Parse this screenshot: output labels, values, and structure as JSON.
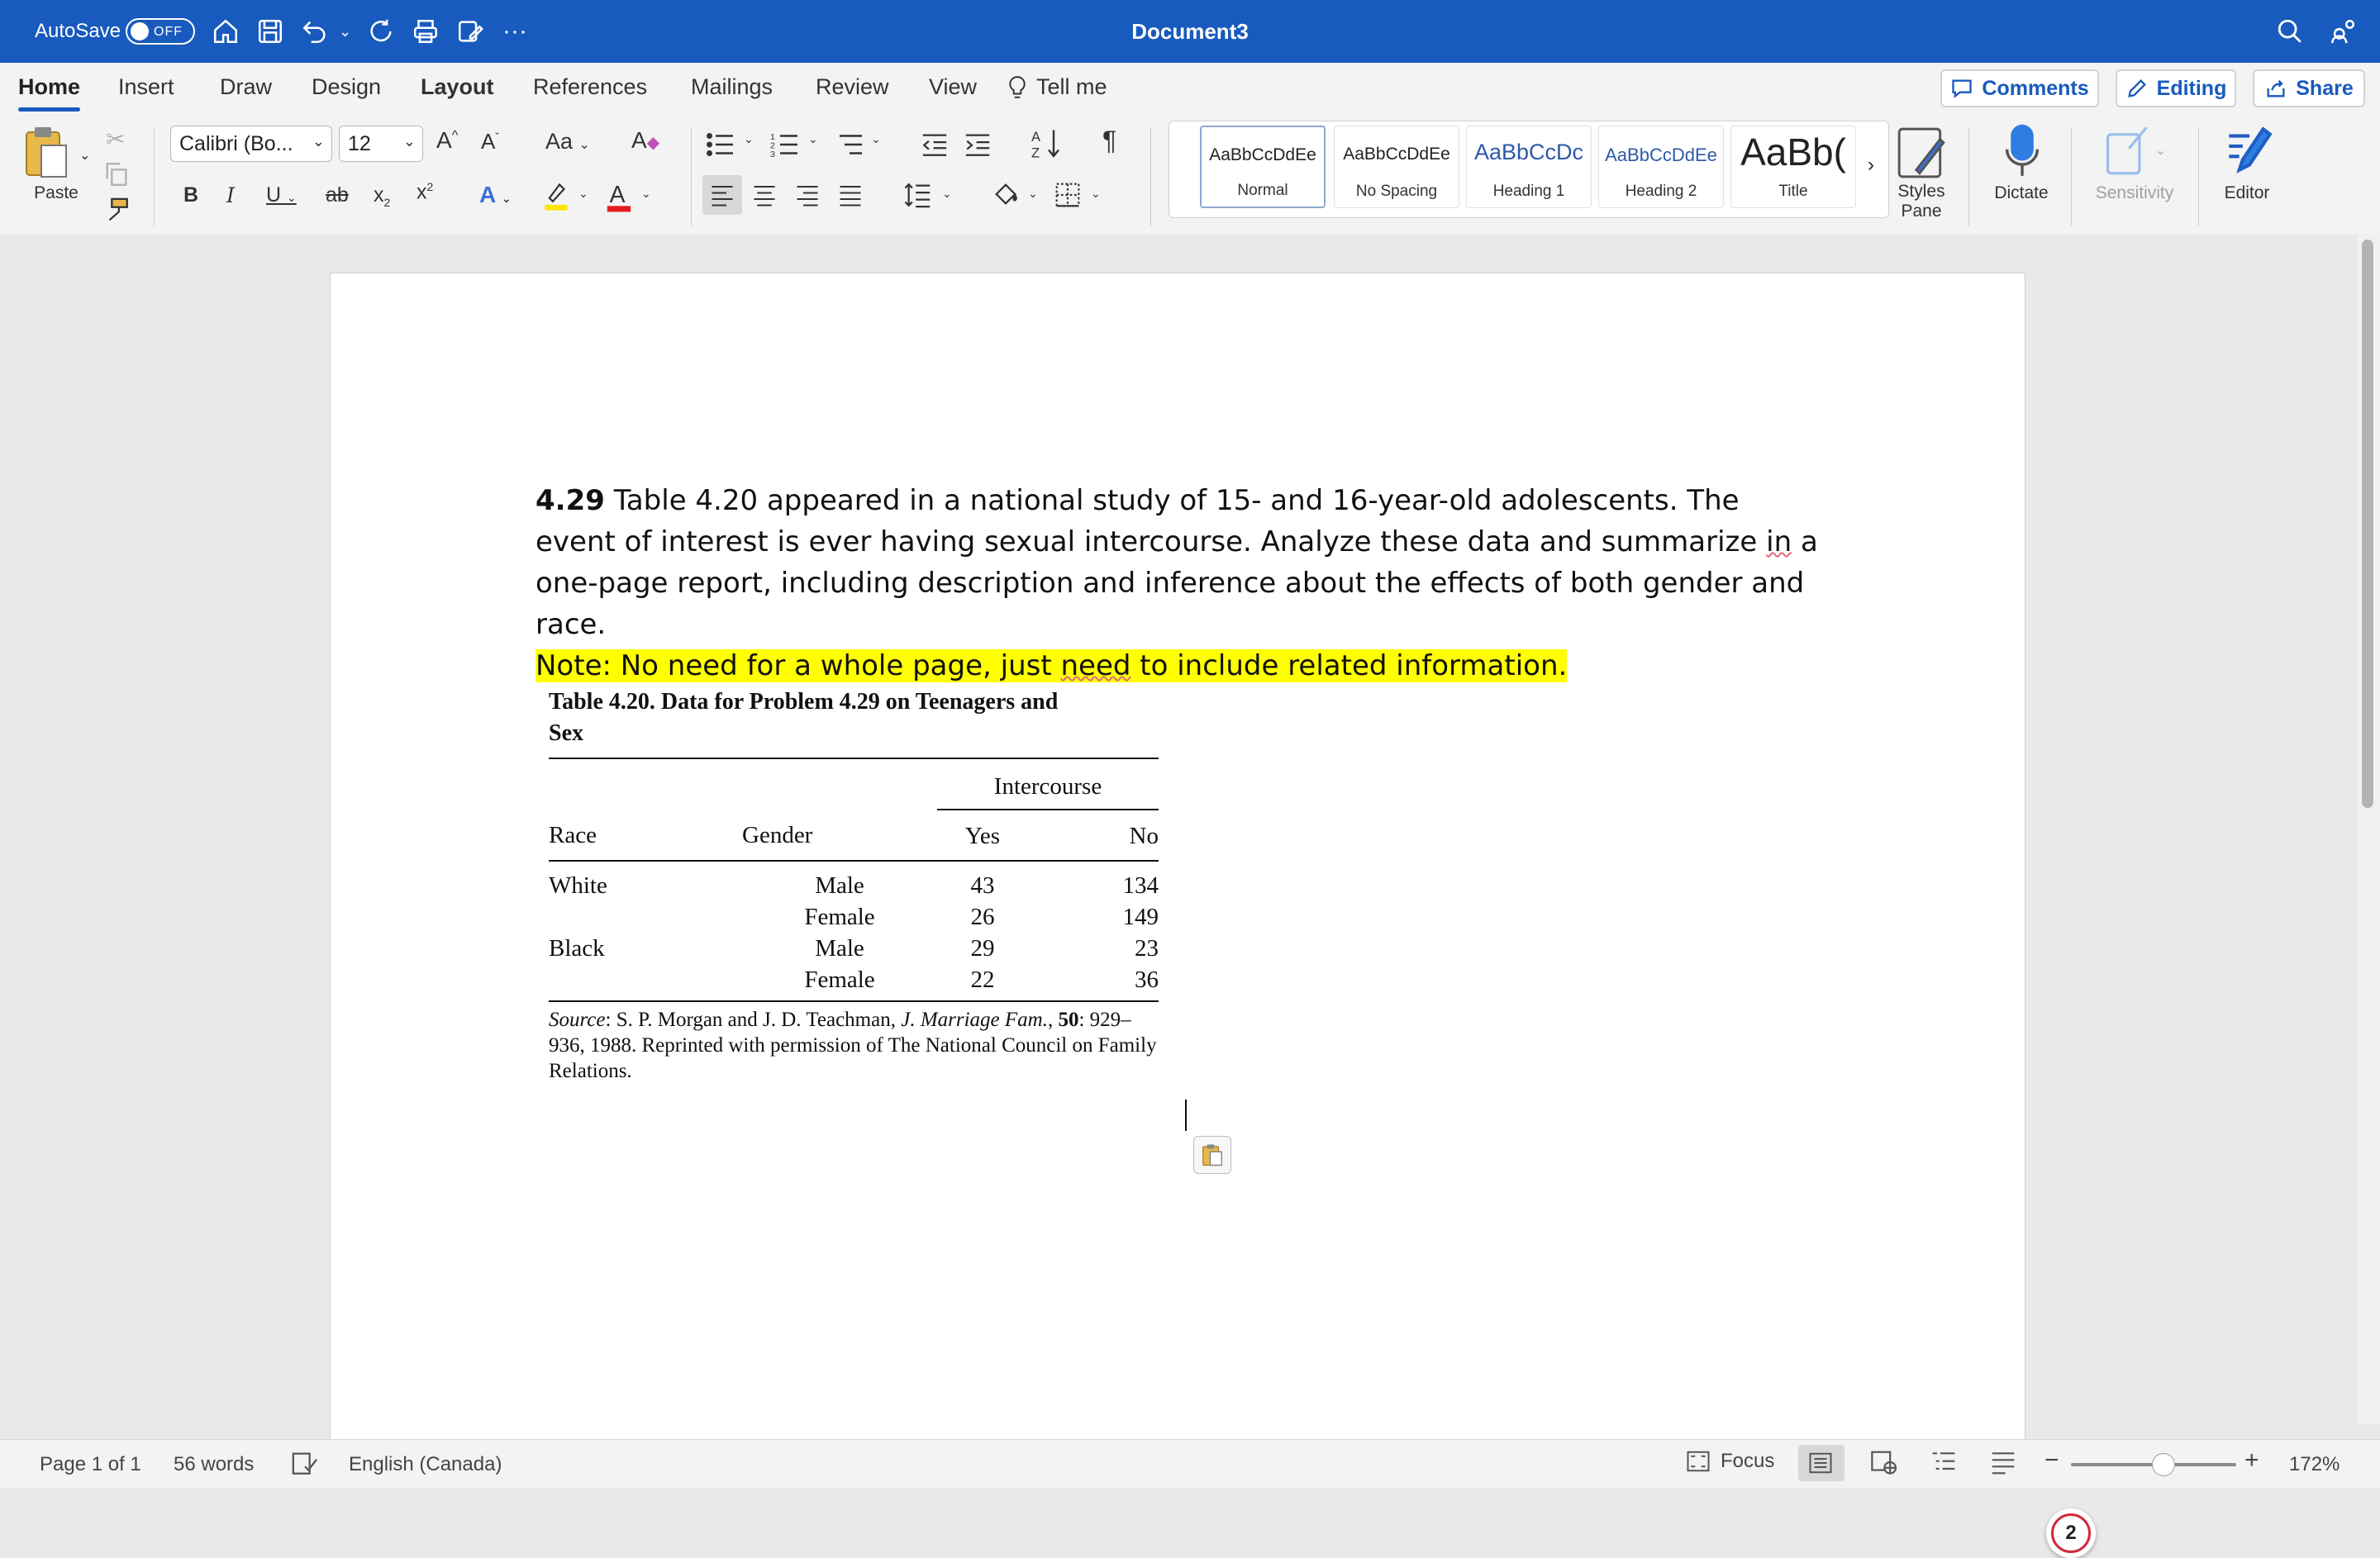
{
  "titlebar": {
    "autosave_label": "AutoSave",
    "autosave_state": "OFF",
    "doc_title": "Document3",
    "qat_icons": [
      "home-icon",
      "save-icon",
      "undo-icon",
      "redo-icon",
      "print-icon",
      "edit-doc-icon",
      "more-icon"
    ]
  },
  "tabs": [
    "Home",
    "Insert",
    "Draw",
    "Design",
    "Layout",
    "References",
    "Mailings",
    "Review",
    "View"
  ],
  "tell_me": "Tell me",
  "top_buttons": {
    "comments": "Comments",
    "editing": "Editing",
    "share": "Share"
  },
  "ribbon": {
    "paste_label": "Paste",
    "font_name": "Calibri (Bo...",
    "font_size": "12",
    "styles": [
      {
        "sample": "AaBbCcDdEe",
        "name": "Normal"
      },
      {
        "sample": "AaBbCcDdEe",
        "name": "No Spacing"
      },
      {
        "sample": "AaBbCcDc",
        "name": "Heading 1"
      },
      {
        "sample": "AaBbCcDdEe",
        "name": "Heading 2"
      },
      {
        "sample": "AaBb(",
        "name": "Title"
      }
    ],
    "styles_pane": "Styles Pane",
    "dictate": "Dictate",
    "sensitivity": "Sensitivity",
    "editor": "Editor"
  },
  "document": {
    "problem_number": "4.29",
    "problem_text_1": " Table 4.20 appeared in a national study of 15- and 16-year-old adolescents. The event of interest is ever having sexual intercourse. Analyze these data and summarize ",
    "problem_word_in": "in",
    "problem_text_2": " a one-page report, including description and inference about the effects of both gender and race.",
    "note_1": "Note: No need for a whole page, just ",
    "note_word_need": "need",
    "note_2": " to include related information.",
    "table_caption": "Table  4.20.  Data for Problem 4.29 on Teenagers and Sex",
    "table_group_header": "Intercourse",
    "table_headers": [
      "Race",
      "Gender",
      "Yes",
      "No"
    ],
    "table_rows": [
      [
        "White",
        "Male",
        "43",
        "134"
      ],
      [
        "",
        "Female",
        "26",
        "149"
      ],
      [
        "Black",
        "Male",
        "29",
        "23"
      ],
      [
        "",
        "Female",
        "22",
        "36"
      ]
    ],
    "source_label": "Source",
    "source_text_1": ":  S. P. Morgan and J. D. Teachman, ",
    "source_journal": "J. Marriage Fam.",
    "source_text_2": ", ",
    "source_volume": "50",
    "source_text_3": ": 929–936, 1988. Reprinted with permission of The National Council on Family Relations.",
    "badge_count": "2"
  },
  "statusbar": {
    "page": "Page 1 of 1",
    "words": "56 words",
    "language": "English (Canada)",
    "focus": "Focus",
    "zoom": "172%"
  }
}
